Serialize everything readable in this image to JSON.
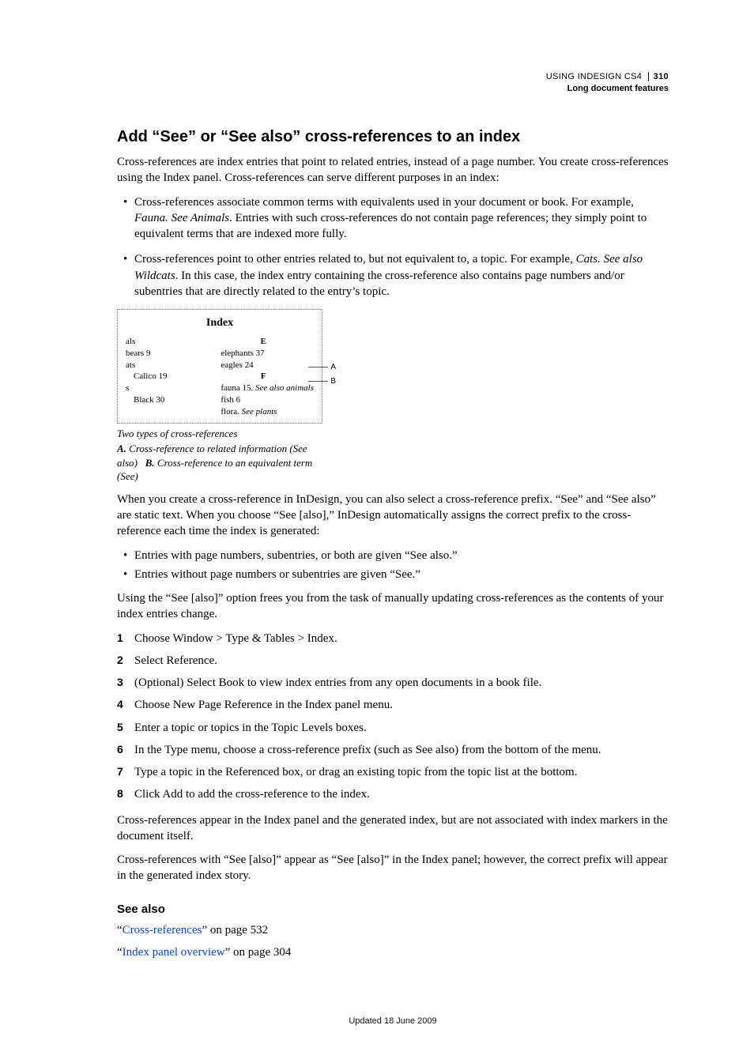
{
  "header": {
    "product": "USING INDESIGN CS4",
    "page_number": "310",
    "chapter": "Long document features"
  },
  "title": "Add “See” or “See also” cross-references to an index",
  "intro": "Cross-references are index entries that point to related entries, instead of a page number. You create cross-references using the Index panel. Cross-references can serve different purposes in an index:",
  "bullets1": [
    {
      "pre": "Cross-references associate common terms with equivalents used in your document or book. For example, ",
      "em": "Fauna. See Animals",
      "post": ". Entries with such cross-references do not contain page references; they simply point to equivalent terms that are indexed more fully."
    },
    {
      "pre": "Cross-references point to other entries related to, but not equivalent to, a topic. For example, ",
      "em": "Cats. See also Wildcats",
      "post": ". In this case, the index entry containing the cross-reference also contains page numbers and/or subentries that are directly related to the entry’s topic."
    }
  ],
  "figure": {
    "index_title": "Index",
    "left": {
      "e1": "als",
      "e2": "bears 9",
      "e3": "ats",
      "e4": "Calico 19",
      "e5": "s",
      "e6": "Black 30"
    },
    "right": {
      "E": "E",
      "e1": "elephants 37",
      "e2": "eagles 24",
      "F": "F",
      "f1_pre": "fauna 15. ",
      "f1_em": "See also animals",
      "f2": "fish 6",
      "f3_pre": "flora. ",
      "f3_em": "See plants"
    },
    "labelA": "A",
    "labelB": "B",
    "caption": "Two types of cross-references",
    "keyA_label": "A.",
    "keyA_text": "Cross-reference to related information (See also)",
    "keyB_label": "B.",
    "keyB_text": "Cross-reference to an equivalent term (See)"
  },
  "para2": "When you create a cross-reference in InDesign, you can also select a cross-reference prefix. “See” and “See also” are static text. When you choose “See [also],” InDesign automatically assigns the correct prefix to the cross-reference each time the index is generated:",
  "bullets2": [
    "Entries with page numbers, subentries, or both are given “See also.”",
    "Entries without page numbers or subentries are given “See.”"
  ],
  "para3": "Using the “See [also]” option frees you from the task of manually updating cross-references as the contents of your index entries change.",
  "steps": [
    "Choose Window > Type & Tables > Index.",
    "Select Reference.",
    "(Optional) Select Book to view index entries from any open documents in a book file.",
    "Choose New Page Reference in the Index panel menu.",
    "Enter a topic or topics in the Topic Levels boxes.",
    "In the Type menu, choose a cross-reference prefix (such as See also) from the bottom of the menu.",
    "Type a topic in the Referenced box, or drag an existing topic from the topic list at the bottom.",
    "Click Add to add the cross-reference to the index."
  ],
  "para4": "Cross-references appear in the Index panel and the generated index, but are not associated with index markers in the document itself.",
  "para5": "Cross-references with “See [also]” appear as “See [also]” in the Index panel; however, the correct prefix will appear in the generated index story.",
  "see_also": {
    "heading": "See also",
    "links": [
      {
        "q1": "“",
        "text": "Cross-references",
        "q2": "” on page 532"
      },
      {
        "q1": "“",
        "text": "Index panel overview",
        "q2": "” on page 304"
      }
    ]
  },
  "footer": "Updated 18 June 2009"
}
